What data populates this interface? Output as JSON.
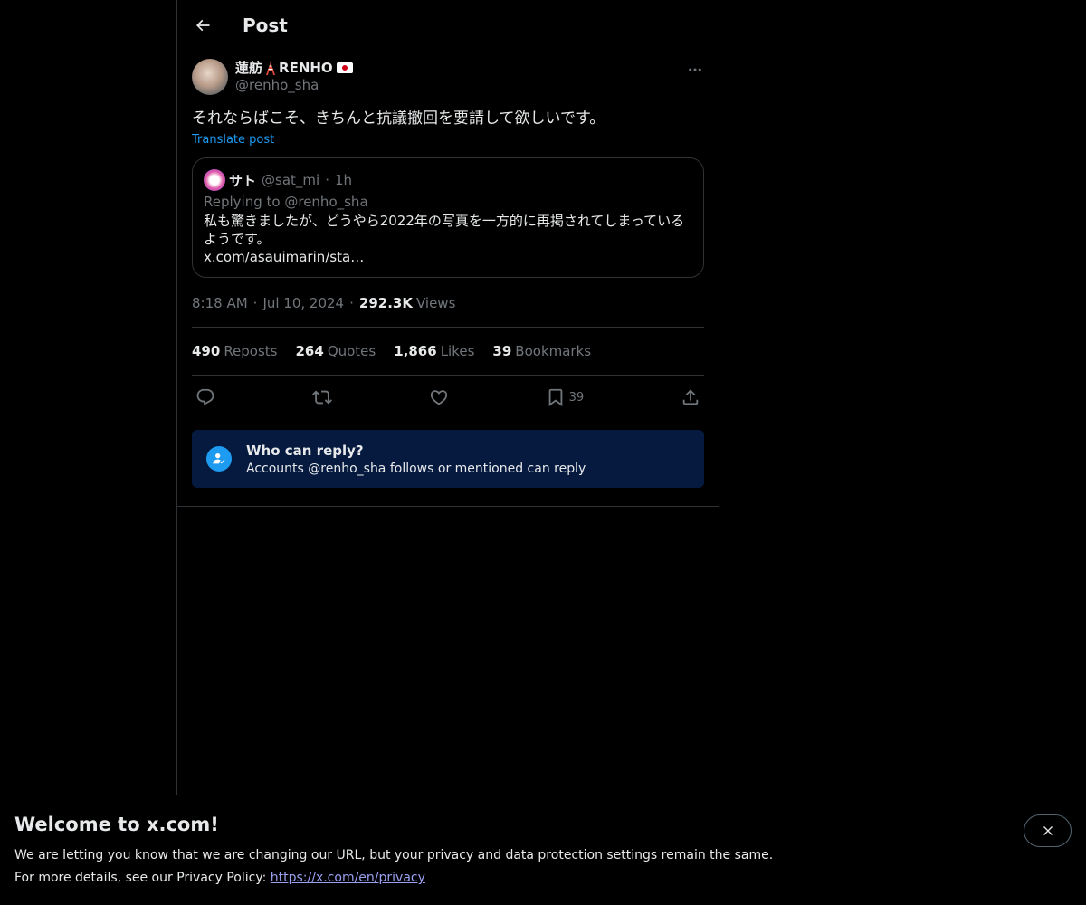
{
  "header": {
    "title": "Post"
  },
  "post": {
    "author": {
      "display_name": "蓮舫",
      "display_name_suffix": "RENHO",
      "handle": "@renho_sha"
    },
    "text": "それならばこそ、きちんと抗議撤回を要請して欲しいです。",
    "translate_label": "Translate post",
    "quote": {
      "name": "サト",
      "handle": "@sat_mi",
      "dot": "·",
      "time": "1h",
      "replying_label": "Replying to",
      "replying_handle": "@renho_sha",
      "text": "私も驚きましたが、どうやら2022年の写真を一方的に再掲されてしまっている\nようです。\nx.com/asauimarin/sta…"
    },
    "meta": {
      "time": "8:18 AM",
      "dot": "·",
      "date": "Jul 10, 2024",
      "views_count": "292.3K",
      "views_label": "Views"
    },
    "stats": {
      "reposts_count": "490",
      "reposts_label": "Reposts",
      "quotes_count": "264",
      "quotes_label": "Quotes",
      "likes_count": "1,866",
      "likes_label": "Likes",
      "bookmarks_count": "39",
      "bookmarks_label": "Bookmarks"
    },
    "actions": {
      "bookmark_count": "39"
    },
    "who_can_reply": {
      "title": "Who can reply?",
      "subtitle": "Accounts @renho_sha follows or mentioned can reply"
    }
  },
  "banner": {
    "title": "Welcome to x.com!",
    "line1": "We are letting you know that we are changing our URL, but your privacy and data protection settings remain the same.",
    "line2_prefix": "For more details, see our Privacy Policy:",
    "link": "https://x.com/en/privacy"
  },
  "colors": {
    "background": "#000000",
    "text": "#e7e9ea",
    "muted": "#71767b",
    "accent": "#1d9bf0",
    "reply_box_bg": "#061a40",
    "border": "#2f3336"
  },
  "icons": {
    "back": "arrow-left-icon",
    "more": "more-horizontal-icon",
    "reply": "reply-icon",
    "repost": "repost-icon",
    "like": "heart-icon",
    "bookmark": "bookmark-icon",
    "share": "share-icon",
    "who_can_reply": "person-check-icon",
    "close": "close-icon",
    "tower_emoji": "tokyo-tower-icon",
    "flag": "japan-flag-icon"
  }
}
